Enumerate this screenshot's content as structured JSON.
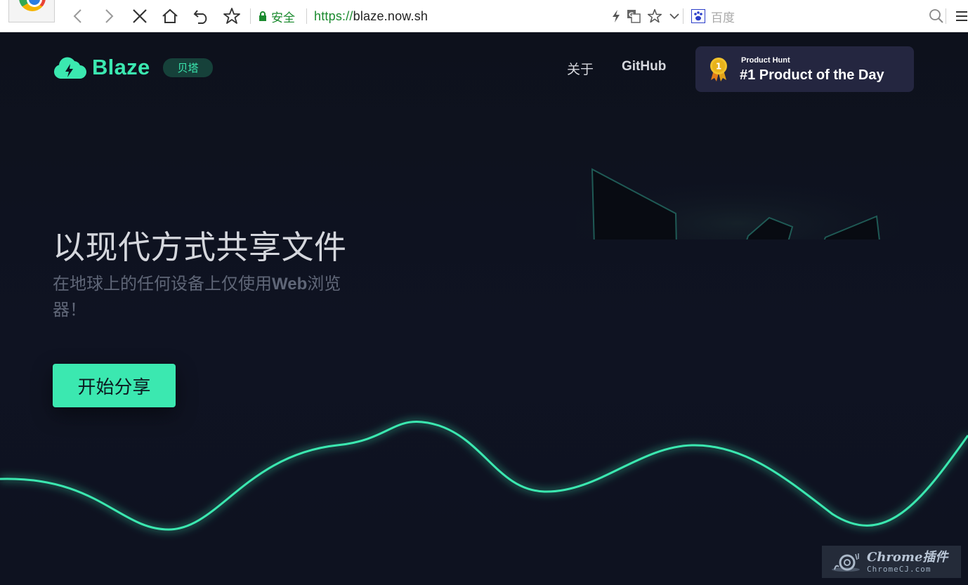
{
  "browser": {
    "security_label": "安全",
    "url_scheme": "https://",
    "url_host": "blaze.now.sh",
    "search_engine_placeholder": "百度",
    "icons": [
      "back-icon",
      "forward-icon",
      "stop-icon",
      "home-icon",
      "undo-icon",
      "star-icon",
      "lock-icon",
      "lightning-icon",
      "translate-icon",
      "star-icon",
      "chevron-down-icon",
      "baidu-icon",
      "search-icon",
      "menu-icon"
    ]
  },
  "header": {
    "brand_name": "Blaze",
    "brand_tag": "贝塔",
    "nav": {
      "about": "关于",
      "github": "GitHub"
    },
    "product_hunt": {
      "small_label": "Product Hunt",
      "title": "#1 Product of the Day",
      "medal_number": "1"
    }
  },
  "hero": {
    "title": "以现代方式共享文件",
    "subtitle_prefix": "在地球上的任何设备上仅使用",
    "subtitle_web": "Web",
    "subtitle_suffix": "浏览器！",
    "cta_label": "开始分享"
  },
  "watermark": {
    "main": "Chrome插件",
    "sub": "ChromeCJ.com"
  },
  "colors": {
    "accent": "#3be8b0",
    "background": "#0f1320",
    "badge_bg": "#242640",
    "tag_bg": "#16413a"
  }
}
